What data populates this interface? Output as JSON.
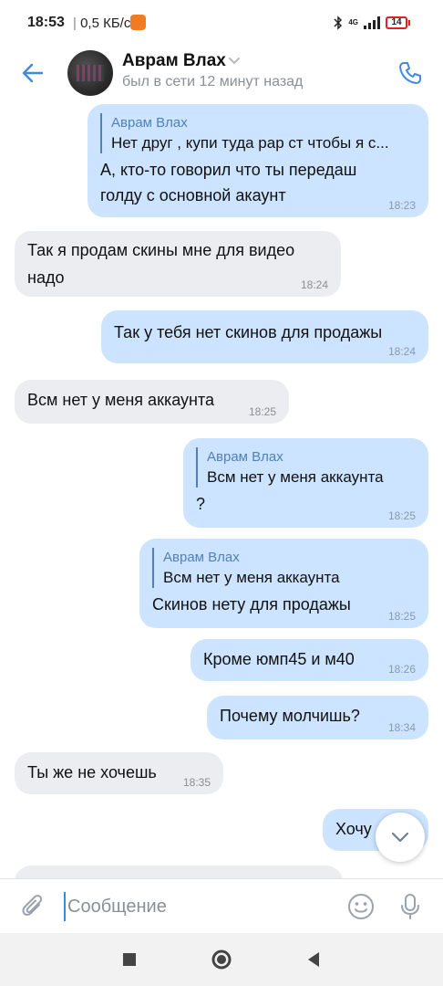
{
  "status_bar": {
    "time": "18:53",
    "net_speed": "0,5 КБ/с",
    "lte_label": "4G",
    "battery_level": "14",
    "battery_color": "#dd2222"
  },
  "header": {
    "contact_name": "Аврам Влах",
    "contact_status": "был в сети 12 минут назад",
    "accent_color": "#3f8ae0"
  },
  "messages": [
    {
      "direction": "out",
      "reply_author": "Аврам Влах",
      "reply_text": "Нет друг , купи туда рар ст чтобы я с...",
      "text": "А, кто-то говорил что ты передаш\nголду с основной акаунт",
      "time": "18:23"
    },
    {
      "direction": "in",
      "text": "Так я продам скины мне для видео\nнадо",
      "time": "18:24"
    },
    {
      "direction": "out",
      "text": "Так у тебя нет скинов для продажы",
      "time": "18:24"
    },
    {
      "direction": "in",
      "text": "Всм нет у меня аккаунта",
      "time": "18:25"
    },
    {
      "direction": "out",
      "reply_author": "Аврам Влах",
      "reply_text": "Всм нет у меня аккаунта",
      "text": "?",
      "time": "18:25"
    },
    {
      "direction": "out",
      "reply_author": "Аврам Влах",
      "reply_text": "Всм нет у меня аккаунта",
      "text": "Скинов нету для продажы",
      "time": "18:25"
    },
    {
      "direction": "out",
      "text": "Кроме юмп45 и м40",
      "time": "18:26"
    },
    {
      "direction": "out",
      "text": "Почему молчишь?",
      "time": "18:34"
    },
    {
      "direction": "in",
      "text": "Ты же не хочешь",
      "time": "18:35"
    },
    {
      "direction": "out",
      "text": "Хочу",
      "time": ""
    }
  ],
  "composer": {
    "placeholder": "Сообщение"
  },
  "icons": {
    "back": "back-arrow-icon",
    "call": "phone-icon",
    "attach": "paperclip-icon",
    "emoji": "smile-icon",
    "mic": "microphone-icon",
    "scroll": "chevron-down-icon"
  }
}
